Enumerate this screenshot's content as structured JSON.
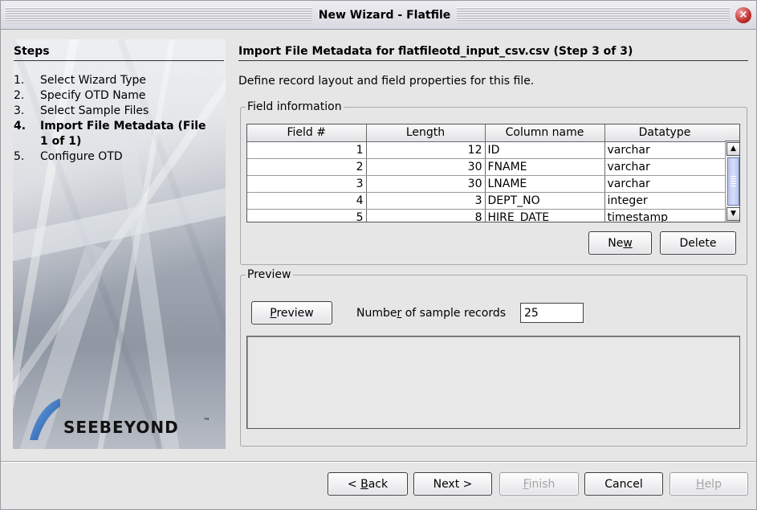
{
  "window": {
    "title": "New Wizard - Flatfile",
    "close_glyph": "×"
  },
  "steps": {
    "heading": "Steps",
    "items": [
      {
        "num": "1.",
        "label": "Select Wizard Type",
        "active": false
      },
      {
        "num": "2.",
        "label": "Specify OTD Name",
        "active": false
      },
      {
        "num": "3.",
        "label": "Select Sample Files",
        "active": false
      },
      {
        "num": "4.",
        "label": "Import File Metadata (File 1 of 1)",
        "active": true
      },
      {
        "num": "5.",
        "label": "Configure OTD",
        "active": false
      }
    ],
    "logo_text": "SEEBEYOND",
    "logo_tm": "™"
  },
  "main": {
    "heading": "Import File Metadata for flatfileotd_input_csv.csv (Step 3 of 3)",
    "description": "Define record layout and field properties for this file.",
    "field_info": {
      "legend": "Field information",
      "columns": [
        "Field #",
        "Length",
        "Column name",
        "Datatype"
      ],
      "rows": [
        {
          "field": "1",
          "length": "12",
          "column": "ID",
          "datatype": "varchar"
        },
        {
          "field": "2",
          "length": "30",
          "column": "FNAME",
          "datatype": "varchar"
        },
        {
          "field": "3",
          "length": "30",
          "column": "LNAME",
          "datatype": "varchar"
        },
        {
          "field": "4",
          "length": "3",
          "column": "DEPT_NO",
          "datatype": "integer"
        },
        {
          "field": "5",
          "length": "8",
          "column": "HIRE_DATE",
          "datatype": "timestamp"
        }
      ],
      "new_button": {
        "pre": "Ne",
        "mn": "w",
        "post": ""
      },
      "delete_button": "Delete"
    },
    "preview": {
      "legend": "Preview",
      "preview_button": {
        "pre": "",
        "mn": "P",
        "post": "review"
      },
      "num_records_label": {
        "pre": "Numbe",
        "mn": "r",
        "post": " of sample records"
      },
      "num_records_value": "25"
    }
  },
  "footer": {
    "back": {
      "pre": "< ",
      "mn": "B",
      "post": "ack"
    },
    "next": "Next >",
    "finish": {
      "pre": "",
      "mn": "F",
      "post": "inish"
    },
    "cancel": "Cancel",
    "help": {
      "pre": "",
      "mn": "H",
      "post": "elp"
    }
  }
}
